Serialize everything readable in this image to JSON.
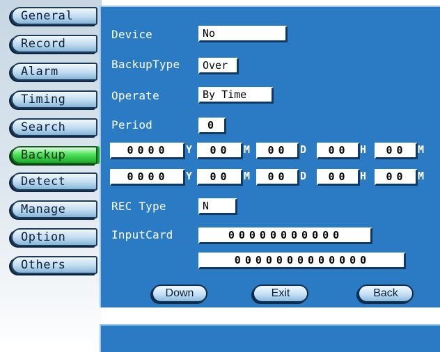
{
  "sidebar": {
    "items": [
      {
        "label": "General"
      },
      {
        "label": "Record"
      },
      {
        "label": "Alarm"
      },
      {
        "label": "Timing"
      },
      {
        "label": "Search"
      },
      {
        "label": "Backup"
      },
      {
        "label": "Detect"
      },
      {
        "label": "Manage"
      },
      {
        "label": "Option"
      },
      {
        "label": "Others"
      }
    ],
    "active_label": "Backup",
    "active_color": "#1ea82a"
  },
  "form": {
    "device": {
      "label": "Device",
      "value": "No"
    },
    "backup_type": {
      "label": "BackupType",
      "value": "Over"
    },
    "operate": {
      "label": "Operate",
      "value": "By Time"
    },
    "period": {
      "label": "Period",
      "value": "0"
    },
    "start": {
      "year": "0000",
      "year_unit": "Y",
      "month": "00",
      "month_unit": "M",
      "day": "00",
      "day_unit": "D",
      "hour": "00",
      "hour_unit": "H",
      "minute": "00",
      "minute_unit": "M"
    },
    "end": {
      "year": "0000",
      "year_unit": "Y",
      "month": "00",
      "month_unit": "M",
      "day": "00",
      "day_unit": "D",
      "hour": "00",
      "hour_unit": "H",
      "minute": "00",
      "minute_unit": "M"
    },
    "rec_type": {
      "label": "REC Type",
      "value": "N"
    },
    "input_card": {
      "label": "InputCard",
      "line1": "00000000000",
      "line2": "0000000000000"
    }
  },
  "buttons": {
    "down": "Down",
    "exit": "Exit",
    "back": "Back"
  },
  "colors": {
    "panel": "#2a7bc4",
    "button": "#c5e0f4"
  }
}
